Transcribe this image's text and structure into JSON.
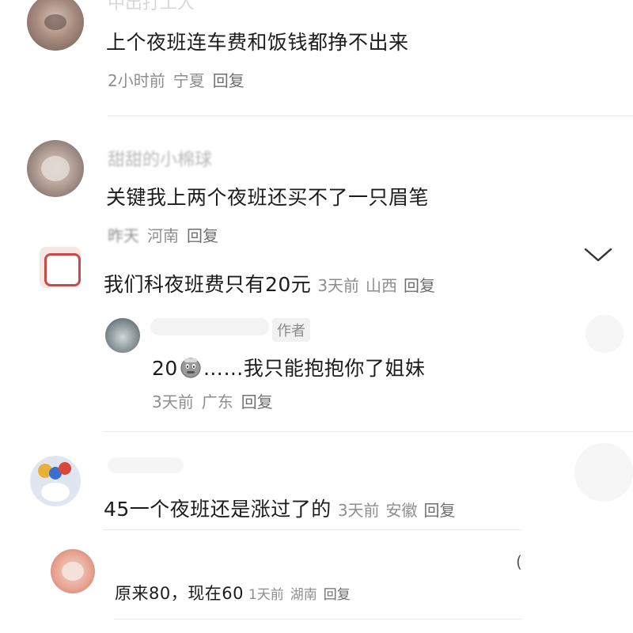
{
  "comments": [
    {
      "username": "中出打工人",
      "text": "上个夜班连车费和饭钱都挣不出来",
      "time": "2小时前",
      "location": "宁夏",
      "reply": "回复"
    },
    {
      "username": "甜甜的小棉球",
      "text": "关键我上两个夜班还买不了一只眉笔",
      "time": "昨天",
      "location": "河南",
      "reply": "回复"
    },
    {
      "text": "我们科夜班费只有20元",
      "time": "3天前",
      "location": "山西",
      "reply": "回复",
      "replies": [
        {
          "author_tag": "作者",
          "text_prefix": "20",
          "emoji": "face-with-bandage-icon",
          "text_suffix": "……我只能抱抱你了姐妹",
          "time": "3天前",
          "location": "广东",
          "reply": "回复"
        }
      ]
    },
    {
      "text": "45一个夜班还是涨过了的",
      "time": "3天前",
      "location": "安徽",
      "reply": "回复"
    },
    {
      "text": "原来80，现在60",
      "time": "1天前",
      "location": "湖南",
      "reply": "回复"
    }
  ],
  "icons": {
    "collapse": "chevron-down-icon"
  },
  "colors": {
    "text": "#1c1c1c",
    "meta": "#8e8e8e",
    "divider": "#ededed"
  }
}
